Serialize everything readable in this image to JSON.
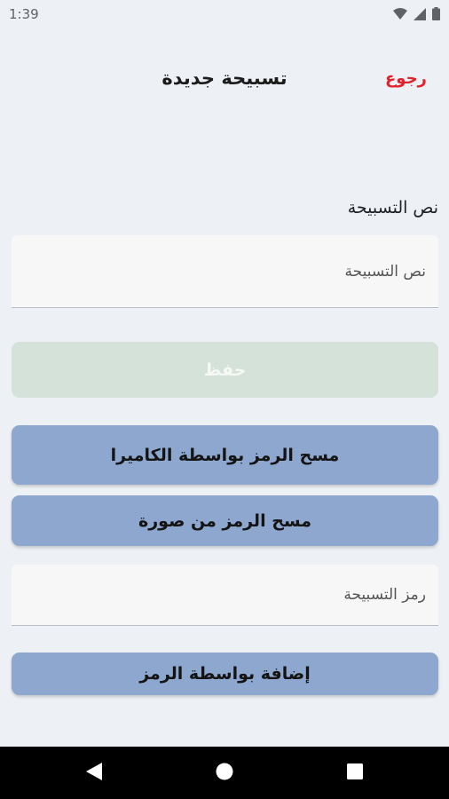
{
  "status_bar": {
    "time": "1:39"
  },
  "header": {
    "title": "تسبيحة جديدة",
    "back_label": "رجوع"
  },
  "form": {
    "text_label": "نص التسبيحة",
    "text_placeholder": "نص التسبيحة",
    "save_label": "حفظ",
    "scan_camera_label": "مسح الرمز بواسطة الكاميرا",
    "scan_image_label": "مسح الرمز من صورة",
    "code_placeholder": "رمز التسبيحة",
    "add_by_code_label": "إضافة بواسطة الرمز"
  },
  "colors": {
    "background": "#edf1f5",
    "accent_red": "#e1212b",
    "button_blue": "#8da7cf",
    "save_disabled": "#d4e2da"
  },
  "icons": [
    "wifi-icon",
    "signal-icon",
    "battery-icon",
    "back-triangle-icon",
    "home-circle-icon",
    "recents-square-icon"
  ]
}
